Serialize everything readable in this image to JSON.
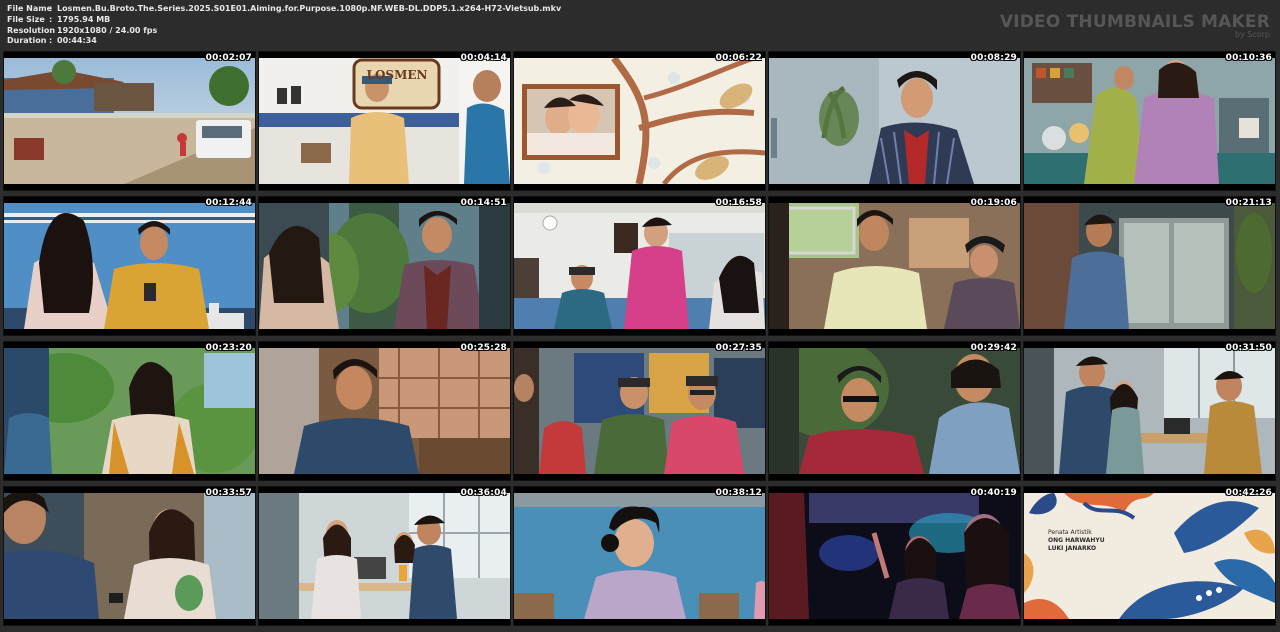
{
  "header": {
    "rows": [
      {
        "key": "File Name",
        "sep": ":",
        "value": "Losmen.Bu.Broto.The.Series.2025.S01E01.Aiming.for.Purpose.1080p.NF.WEB-DL.DDP5.1.x264-H72-Vietsub.mkv"
      },
      {
        "key": "File Size",
        "sep": ":",
        "value": "1795.94 MB"
      },
      {
        "key": "Resolution",
        "sep": ":",
        "value": "1920x1080 / 24.00 fps"
      },
      {
        "key": "Duration",
        "sep": ":",
        "value": "00:44:34"
      }
    ],
    "brand_title": "VIDEO THUMBNAILS MAKER",
    "brand_sub": "by Scorp"
  },
  "thumbnails": [
    {
      "timestamp": "00:02:07",
      "scene": "street-outdoor"
    },
    {
      "timestamp": "00:04:14",
      "scene": "man-yellow-sign"
    },
    {
      "timestamp": "00:06:22",
      "scene": "photo-on-branch-art"
    },
    {
      "timestamp": "00:08:29",
      "scene": "young-man-smiling"
    },
    {
      "timestamp": "00:10:36",
      "scene": "kitchen-woman"
    },
    {
      "timestamp": "00:12:44",
      "scene": "man-phone-table"
    },
    {
      "timestamp": "00:14:51",
      "scene": "young-man-garden"
    },
    {
      "timestamp": "00:16:58",
      "scene": "woman-pink-kebaya"
    },
    {
      "timestamp": "00:19:06",
      "scene": "car-interior"
    },
    {
      "timestamp": "00:21:13",
      "scene": "man-by-glass-door"
    },
    {
      "timestamp": "00:23:20",
      "scene": "woman-plants"
    },
    {
      "timestamp": "00:25:28",
      "scene": "young-man-window"
    },
    {
      "timestamp": "00:27:35",
      "scene": "two-men-batik"
    },
    {
      "timestamp": "00:29:42",
      "scene": "man-glasses-closeup"
    },
    {
      "timestamp": "00:31:50",
      "scene": "office-desk"
    },
    {
      "timestamp": "00:33:57",
      "scene": "woman-phone-cafe"
    },
    {
      "timestamp": "00:36:04",
      "scene": "people-at-cafe-table"
    },
    {
      "timestamp": "00:38:12",
      "scene": "woman-blue-wall"
    },
    {
      "timestamp": "00:40:19",
      "scene": "club-dancing"
    },
    {
      "timestamp": "00:42:26",
      "scene": "batik-credits"
    }
  ],
  "credits": {
    "role": "Penata Artistik",
    "names": [
      "ONG HARWAHYU",
      "LUKI JANARKO"
    ]
  },
  "sign_text": "LOSMEN"
}
